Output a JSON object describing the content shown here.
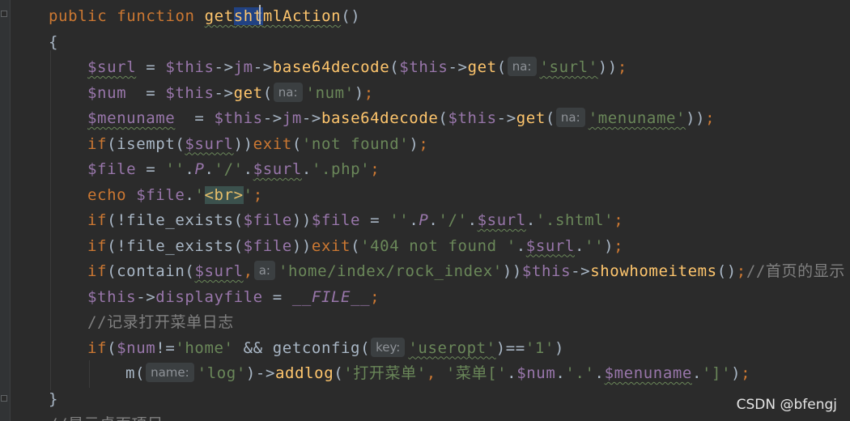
{
  "editor": {
    "lines": [
      [
        [
          "kw",
          "public function "
        ],
        [
          "fn",
          "get"
        ],
        [
          "fnsel",
          "sht"
        ],
        [
          "fn",
          "mlAction"
        ],
        [
          "txt",
          "()"
        ]
      ],
      [
        [
          "txt",
          "{"
        ]
      ],
      [
        [
          "var",
          "$surl"
        ],
        [
          "txt",
          " = "
        ],
        [
          "var",
          "$this"
        ],
        [
          "txt",
          "->"
        ],
        [
          "var",
          "jm"
        ],
        [
          "txt",
          "->"
        ],
        [
          "fn",
          "base64decode"
        ],
        [
          "txt",
          "("
        ],
        [
          "var",
          "$this"
        ],
        [
          "txt",
          "->"
        ],
        [
          "fn",
          "get"
        ],
        [
          "txt",
          "("
        ],
        [
          "hint",
          "na:"
        ],
        [
          "str",
          "'surl'"
        ],
        [
          "txt",
          "))"
        ],
        [
          "kw",
          ";"
        ]
      ],
      [
        [
          "var",
          "$num"
        ],
        [
          "txt",
          "  = "
        ],
        [
          "var",
          "$this"
        ],
        [
          "txt",
          "->"
        ],
        [
          "fn",
          "get"
        ],
        [
          "txt",
          "("
        ],
        [
          "hint",
          "na:"
        ],
        [
          "str",
          "'num'"
        ],
        [
          "txt",
          ")"
        ],
        [
          "kw",
          ";"
        ]
      ],
      [
        [
          "var",
          "$menuname"
        ],
        [
          "txt",
          "  = "
        ],
        [
          "var",
          "$this"
        ],
        [
          "txt",
          "->"
        ],
        [
          "var",
          "jm"
        ],
        [
          "txt",
          "->"
        ],
        [
          "fn",
          "base64decode"
        ],
        [
          "txt",
          "("
        ],
        [
          "var",
          "$this"
        ],
        [
          "txt",
          "->"
        ],
        [
          "fn",
          "get"
        ],
        [
          "txt",
          "("
        ],
        [
          "hint",
          "na:"
        ],
        [
          "str",
          "'menuname'"
        ],
        [
          "txt",
          "))"
        ],
        [
          "kw",
          ";"
        ]
      ],
      [
        [
          "kw",
          "if"
        ],
        [
          "txt",
          "(isempt("
        ],
        [
          "var",
          "$surl"
        ],
        [
          "txt",
          "))"
        ],
        [
          "kw",
          "exit"
        ],
        [
          "txt",
          "("
        ],
        [
          "str",
          "'not found'"
        ],
        [
          "txt",
          ")"
        ],
        [
          "kw",
          ";"
        ]
      ],
      [
        [
          "var",
          "$file"
        ],
        [
          "txt",
          " = "
        ],
        [
          "str",
          "''"
        ],
        [
          "txt",
          "."
        ],
        [
          "const",
          "P"
        ],
        [
          "txt",
          "."
        ],
        [
          "str",
          "'/'"
        ],
        [
          "txt",
          "."
        ],
        [
          "var",
          "$surl"
        ],
        [
          "txt",
          "."
        ],
        [
          "str",
          "'.php'"
        ],
        [
          "kw",
          ";"
        ]
      ],
      [
        [
          "kw",
          "echo "
        ],
        [
          "var",
          "$file"
        ],
        [
          "txt",
          "."
        ],
        [
          "str",
          "'"
        ],
        [
          "taghl",
          "<br>"
        ],
        [
          "str",
          "'"
        ],
        [
          "kw",
          ";"
        ]
      ],
      [
        [
          "kw",
          "if"
        ],
        [
          "txt",
          "(!file_exists("
        ],
        [
          "var",
          "$file"
        ],
        [
          "txt",
          "))"
        ],
        [
          "var",
          "$file"
        ],
        [
          "txt",
          " = "
        ],
        [
          "str",
          "''"
        ],
        [
          "txt",
          "."
        ],
        [
          "const",
          "P"
        ],
        [
          "txt",
          "."
        ],
        [
          "str",
          "'/'"
        ],
        [
          "txt",
          "."
        ],
        [
          "var",
          "$surl"
        ],
        [
          "txt",
          "."
        ],
        [
          "str",
          "'.shtml'"
        ],
        [
          "kw",
          ";"
        ]
      ],
      [
        [
          "kw",
          "if"
        ],
        [
          "txt",
          "(!file_exists("
        ],
        [
          "var",
          "$file"
        ],
        [
          "txt",
          "))"
        ],
        [
          "kw",
          "exit"
        ],
        [
          "txt",
          "("
        ],
        [
          "str",
          "'404 not found '"
        ],
        [
          "txt",
          "."
        ],
        [
          "var",
          "$surl"
        ],
        [
          "txt",
          "."
        ],
        [
          "str",
          "''"
        ],
        [
          "txt",
          ")"
        ],
        [
          "kw",
          ";"
        ]
      ],
      [
        [
          "kw",
          "if"
        ],
        [
          "txt",
          "(contain("
        ],
        [
          "var",
          "$surl"
        ],
        [
          "kw",
          ","
        ],
        [
          "hint",
          "a:"
        ],
        [
          "str",
          "'home/index/rock_index'"
        ],
        [
          "txt",
          "))"
        ],
        [
          "var",
          "$this"
        ],
        [
          "txt",
          "->"
        ],
        [
          "fn",
          "showhomeitems"
        ],
        [
          "txt",
          "()"
        ],
        [
          "kw",
          ";"
        ],
        [
          "cmt",
          "//首页的显示"
        ]
      ],
      [
        [
          "var",
          "$this"
        ],
        [
          "txt",
          "->"
        ],
        [
          "var",
          "displayfile"
        ],
        [
          "txt",
          " = "
        ],
        [
          "const",
          "__FILE__"
        ],
        [
          "kw",
          ";"
        ]
      ],
      [
        [
          "cmt",
          "//记录打开菜单日志"
        ]
      ],
      [
        [
          "kw",
          "if"
        ],
        [
          "txt",
          "("
        ],
        [
          "var",
          "$num"
        ],
        [
          "txt",
          "!="
        ],
        [
          "str",
          "'home'"
        ],
        [
          "txt",
          " && getconfig("
        ],
        [
          "hint",
          "key:"
        ],
        [
          "str",
          "'useropt'"
        ],
        [
          "txt",
          ")=="
        ],
        [
          "str",
          "'1'"
        ],
        [
          "txt",
          ")"
        ]
      ],
      [
        [
          "txt",
          "m("
        ],
        [
          "hint",
          "name:"
        ],
        [
          "str",
          "'log'"
        ],
        [
          "txt",
          ")->"
        ],
        [
          "fn",
          "addlog"
        ],
        [
          "txt",
          "("
        ],
        [
          "str",
          "'打开菜单'"
        ],
        [
          "kw",
          ", "
        ],
        [
          "str",
          "'菜单['"
        ],
        [
          "txt",
          "."
        ],
        [
          "var",
          "$num"
        ],
        [
          "txt",
          "."
        ],
        [
          "str",
          "'.'"
        ],
        [
          "txt",
          "."
        ],
        [
          "var",
          "$menuname"
        ],
        [
          "txt",
          "."
        ],
        [
          "str",
          "']'"
        ],
        [
          "txt",
          ")"
        ],
        [
          "kw",
          ";"
        ]
      ],
      [
        [
          "txt",
          "}"
        ]
      ],
      [
        [
          "cmt",
          "//显示桌面项目"
        ]
      ]
    ]
  },
  "watermark": "CSDN @bfengj"
}
